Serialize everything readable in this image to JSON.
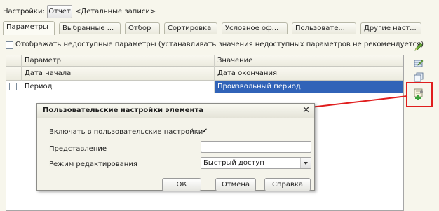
{
  "top": {
    "settings_label": "Настройки:",
    "report_button": "Отчет",
    "description": "<Детальные записи>"
  },
  "tabs": [
    {
      "label": "Параметры",
      "active": true
    },
    {
      "label": "Выбранные ..."
    },
    {
      "label": "Отбор"
    },
    {
      "label": "Сортировка"
    },
    {
      "label": "Условное оф..."
    },
    {
      "label": "Пользовате..."
    },
    {
      "label": "Другие наст..."
    }
  ],
  "options": {
    "show_unavailable_label": "Отображать недоступные параметры (устанавливать значения недоступных параметров не рекомендуется)",
    "show_unavailable_checked": false
  },
  "grid": {
    "headers": {
      "parameter": "Параметр",
      "value": "Значение",
      "start_date": "Дата начала",
      "end_date": "Дата окончания"
    },
    "rows": [
      {
        "checked": false,
        "parameter": "Период",
        "value": "Произвольный период"
      }
    ]
  },
  "toolbar": {
    "icons": [
      "edit-pencil-icon",
      "table-edit-icon",
      "copy-icon",
      "user-settings-icon"
    ]
  },
  "dialog": {
    "title": "Пользовательские настройки элемента",
    "close_glyph": "✕",
    "include_label": "Включать в пользовательские настройки",
    "include_checked": true,
    "check_glyph": "✔",
    "presentation_label": "Представление",
    "presentation_value": "",
    "mode_label": "Режим редактирования",
    "mode_value": "Быстрый доступ",
    "buttons": {
      "ok": "ОК",
      "cancel": "Отмена",
      "help": "Справка"
    }
  },
  "colors": {
    "selection": "#3163b8",
    "annotation": "#e01d1d",
    "background": "#f7f6ec"
  }
}
